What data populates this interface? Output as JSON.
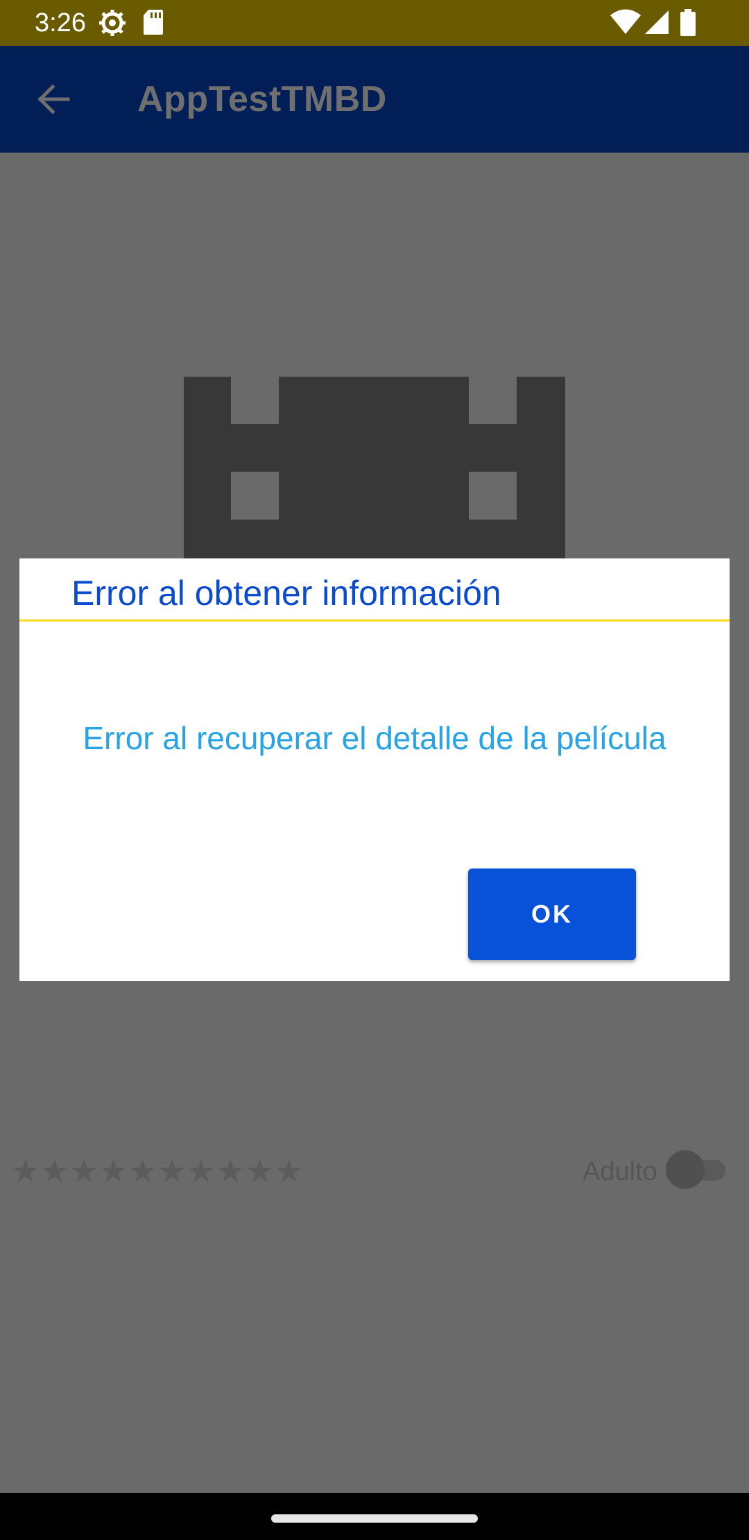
{
  "status_bar": {
    "time": "3:26",
    "icons": [
      "settings-icon",
      "sd-card-icon",
      "wifi-icon",
      "signal-icon",
      "battery-icon"
    ]
  },
  "app_bar": {
    "title": "AppTestTMBD",
    "back_icon": "arrow-left-icon"
  },
  "content": {
    "poster_placeholder_icon": "film-strip-icon",
    "rating_stars": "★★★★★★★★★★",
    "adult_label": "Adulto",
    "adult_switch_on": false
  },
  "dialog": {
    "title": "Error al obtener información",
    "message": "Error al recuperar el detalle de la película",
    "ok_label": "OK"
  },
  "colors": {
    "status_bar": "#6a5b00",
    "app_bar": "#011e57",
    "dialog_title": "#0b4bcf",
    "dialog_divider": "#ffd81a",
    "dialog_message": "#27a3e6",
    "ok_button": "#0752d9"
  }
}
